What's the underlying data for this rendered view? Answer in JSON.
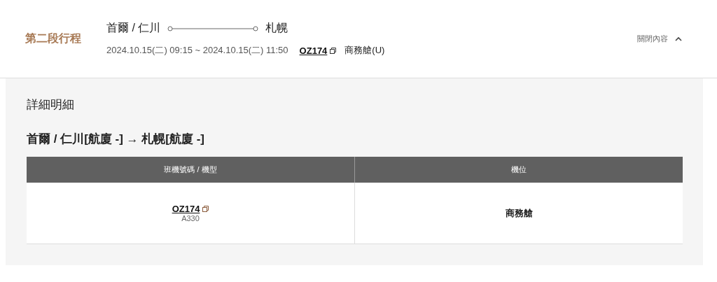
{
  "segment": {
    "label": "第二段行程",
    "origin": "首爾 / 仁川",
    "destination": "札幌",
    "schedule": "2024.10.15(二) 09:15 ~ 2024.10.15(二) 11:50",
    "flight": "OZ174",
    "cabin": "商務艙(U)",
    "toggle": {
      "label": "關閉內容",
      "expanded": true
    }
  },
  "details": {
    "title": "詳細明細",
    "route": "首爾 / 仁川[航廈 -] → 札幌[航廈 -]",
    "table": {
      "columns": [
        "班機號碼 / 機型",
        "機位"
      ],
      "rows": [
        {
          "flight": "OZ174",
          "aircraft": "A330",
          "cabin": "商務艙"
        }
      ]
    }
  }
}
